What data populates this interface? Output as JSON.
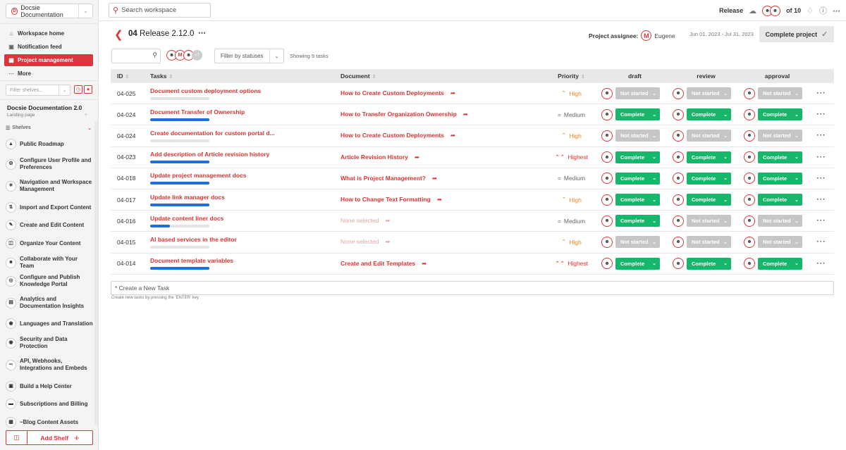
{
  "sidebar": {
    "workspace": "Docsie Documentation",
    "nav": [
      {
        "label": "Workspace home",
        "icon": "home-icon"
      },
      {
        "label": "Notification feed",
        "icon": "inbox-icon"
      },
      {
        "label": "Project management",
        "icon": "kanban-icon",
        "active": true
      },
      {
        "label": "More",
        "icon": "more-icon"
      }
    ],
    "filter_placeholder": "Filter shelves...",
    "doc_title": "Docsie Documentation 2.0",
    "doc_sub": "Landing page",
    "shelves_label": "Shelves",
    "shelves": [
      {
        "label": "Public Roadmap"
      },
      {
        "label": "Configure User Profile and Preferences"
      },
      {
        "label": "Navigation and Workspace Management"
      },
      {
        "label": "Import and Export Content"
      },
      {
        "label": "Create and Edit Content"
      },
      {
        "label": "Organize Your Content"
      },
      {
        "label": "Collaborate with Your Team"
      },
      {
        "label": "Configure and Publish Knowledge Portal"
      },
      {
        "label": "Analytics and Documentation Insights"
      },
      {
        "label": "Languages and Translation"
      },
      {
        "label": "Security and Data Protection"
      },
      {
        "label": "API, Webhooks, Integrations and Embeds"
      },
      {
        "label": "Build a Help Center"
      },
      {
        "label": "Subscriptions and Billing"
      },
      {
        "label": "~Blog Content Assets"
      }
    ],
    "add_shelf": "Add Shelf"
  },
  "topbar": {
    "search_placeholder": "Search workspace",
    "release_label": "Release",
    "counter": "of 10"
  },
  "header": {
    "number": "04",
    "title": "Release 2.12.0",
    "assignee_label": "Project assignee:",
    "assignee_name": "Eugene",
    "dates": "Jun 01, 2023 - Jul 31, 2023",
    "complete_button": "Complete project"
  },
  "filters": {
    "more_count": "+7",
    "status_filter": "Filter by statuses",
    "showing": "Showing 9 tasks"
  },
  "table": {
    "columns": {
      "id": "ID",
      "tasks": "Tasks",
      "document": "Document",
      "priority": "Priority",
      "draft": "draft",
      "review": "review",
      "approval": "approval"
    },
    "rows": [
      {
        "id": "04-025",
        "task": "Document custom deployment options",
        "progress": 0,
        "document": "How to Create Custom Deployments",
        "doc_set": true,
        "priority": "High",
        "draft": "Not started",
        "review": "Not started",
        "approval": "Not started"
      },
      {
        "id": "04-024",
        "task": "Document Transfer of Ownership",
        "progress": 1,
        "document": "How to Transfer Organization Ownership",
        "doc_set": true,
        "priority": "Medium",
        "draft": "Complete",
        "review": "Complete",
        "approval": "Complete"
      },
      {
        "id": "04-024",
        "task": "Create documentation for custom portal d...",
        "progress": 0,
        "document": "How to Create Custom Deployments",
        "doc_set": true,
        "priority": "High",
        "draft": "Not started",
        "review": "Not started",
        "approval": "Not started"
      },
      {
        "id": "04-023",
        "task": "Add description of Article revision history",
        "progress": 1,
        "document": "Article Revision History",
        "doc_set": true,
        "priority": "Highest",
        "draft": "Complete",
        "review": "Complete",
        "approval": "Complete"
      },
      {
        "id": "04-018",
        "task": "Update project management docs",
        "progress": 1,
        "document": "What is Project Management?",
        "doc_set": true,
        "priority": "Medium",
        "draft": "Complete",
        "review": "Complete",
        "approval": "Complete"
      },
      {
        "id": "04-017",
        "task": "Update link manager docs",
        "progress": 1,
        "document": "How to Change Text Formatting",
        "doc_set": true,
        "priority": "High",
        "draft": "Complete",
        "review": "Complete",
        "approval": "Complete"
      },
      {
        "id": "04-016",
        "task": "Update content liner docs",
        "progress": 0.33,
        "document": "None selected",
        "doc_set": false,
        "priority": "Medium",
        "draft": "Complete",
        "review": "Not started",
        "approval": "Not started"
      },
      {
        "id": "04-015",
        "task": "AI based services in the editor",
        "progress": 0,
        "document": "None selected",
        "doc_set": false,
        "priority": "High",
        "draft": "Not started",
        "review": "Not started",
        "approval": "Not started"
      },
      {
        "id": "04-014",
        "task": "Document template variables",
        "progress": 1,
        "document": "Create and Edit Templates",
        "doc_set": true,
        "priority": "Highest",
        "draft": "Complete",
        "review": "Complete",
        "approval": "Complete"
      }
    ]
  },
  "create_task": {
    "placeholder": "* Create a New Task",
    "hint": "Create new tasks by pressing the 'ENTER' key"
  }
}
